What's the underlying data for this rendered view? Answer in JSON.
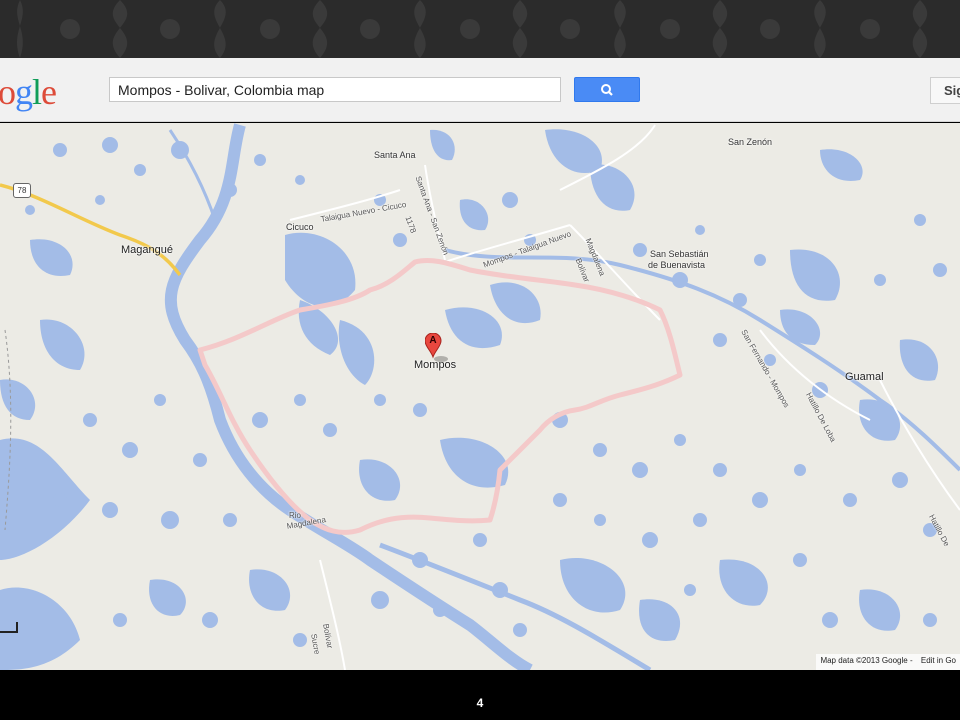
{
  "search": {
    "query": "Mompos - Bolivar, Colombia map"
  },
  "logo": {
    "text": "ogle"
  },
  "header": {
    "signin_label": "Sig"
  },
  "map": {
    "attribution": "Map data ©2013 Google -",
    "edit_link": "Edit in Go",
    "marker_label": "A",
    "route_shield": "78",
    "places": {
      "mompos": "Mompos",
      "magangue": "Magangué",
      "santa_ana": "Santa Ana",
      "san_zenon": "San Zenón",
      "cicuco": "Cicuco",
      "san_sebastian_1": "San Sebastián",
      "san_sebastian_2": "de Buenavista",
      "guamal": "Guamal"
    },
    "roads": {
      "talaigua": "Talaigua Nuevo - Cicuco",
      "santa_ana_san_zenon": "Santa Ana - San Zenón",
      "road_1178": "1178",
      "pompos_talaigua": "Mompos - Talaigua Nuevo",
      "magdalena": "Magdalena",
      "bolivar": "Bolívar",
      "rio_magdalena_1": "Rio",
      "rio_magdalena_2": "Magdalena",
      "bolivar_sucre_1": "Bolívar",
      "bolivar_sucre_2": "Sucre",
      "san_fernando": "San Fernando - Mompos",
      "hatillo_1": "Hatillo De Loba",
      "hatillo_2": "Hatillo De"
    }
  },
  "footer": {
    "page_number": "4"
  },
  "colors": {
    "water": "#a3bce7",
    "land": "#ecebe5",
    "boundary": "#f4c9c9",
    "road": "#f2c94c",
    "search_button": "#4a8bf5"
  }
}
